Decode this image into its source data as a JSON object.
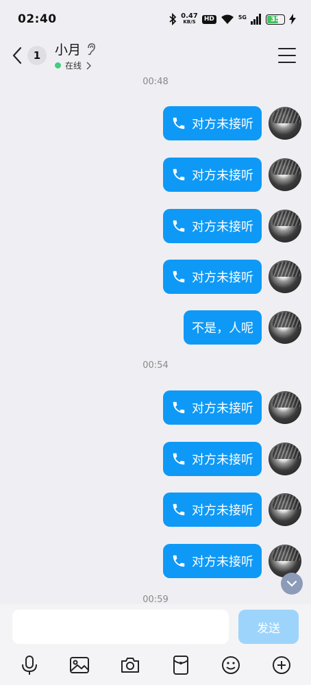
{
  "status_bar": {
    "time": "02:40",
    "speed_value": "0.47",
    "speed_unit": "KB/S",
    "hd": "HD",
    "network": "5G",
    "battery": "35"
  },
  "header": {
    "unread_count": "1",
    "title": "小月",
    "status": "在线"
  },
  "messages": {
    "ts1": "00:48",
    "ts2": "00:54",
    "ts3": "00:59",
    "call_text": "对方未接听",
    "text_msg": "不是，人呢"
  },
  "input": {
    "placeholder": "",
    "send_label": "发送"
  },
  "colors": {
    "bubble": "#0f99f6",
    "online": "#3ed07c",
    "send_disabled": "#9dd4fb"
  }
}
